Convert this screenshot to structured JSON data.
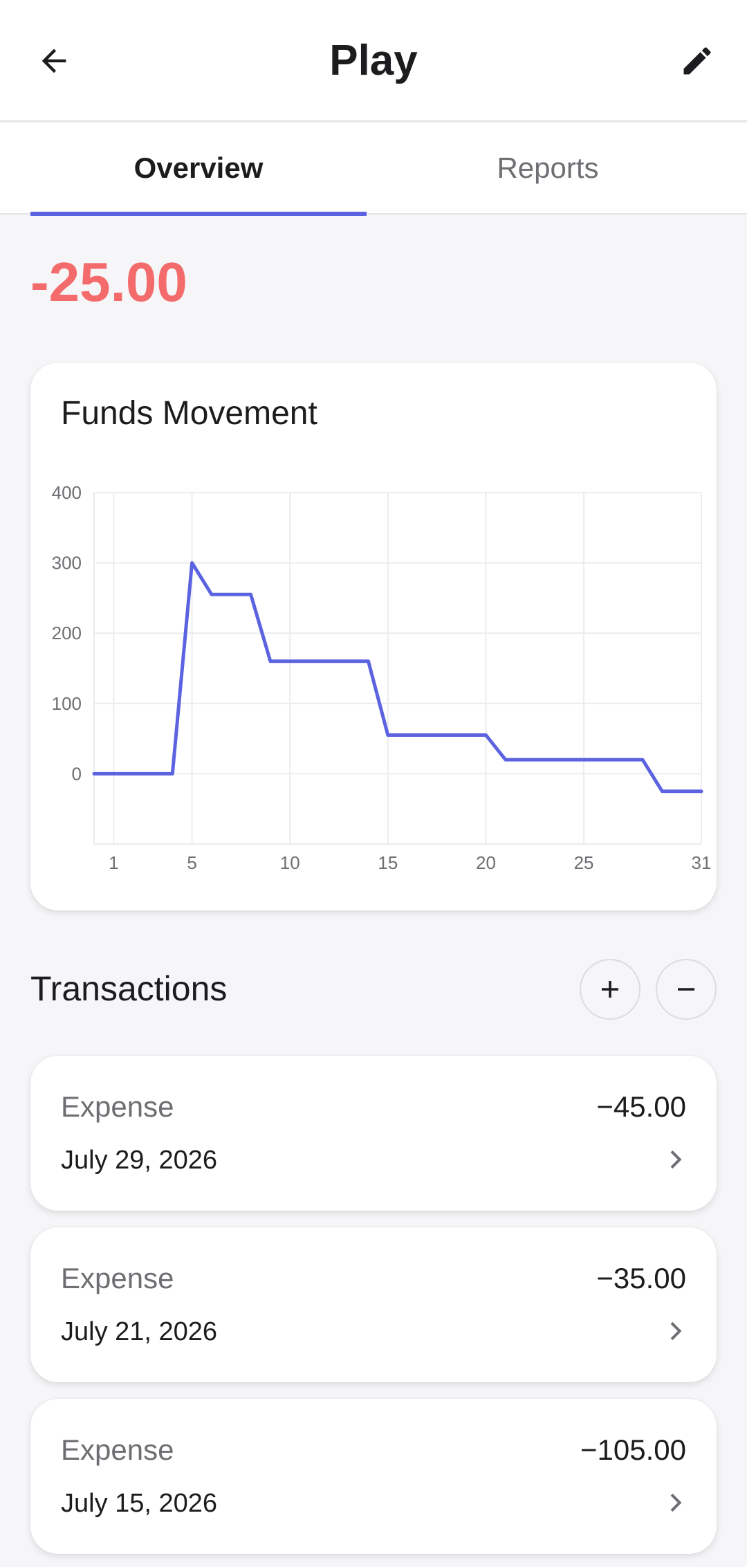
{
  "app_bar": {
    "title": "Play",
    "back_icon": "arrow-left-icon",
    "edit_icon": "pencil-icon"
  },
  "tabs": [
    {
      "label": "Overview",
      "active": true
    },
    {
      "label": "Reports",
      "active": false
    }
  ],
  "balance": {
    "value": "-25.00",
    "color": "#f36b6b"
  },
  "chart_card": {
    "title": "Funds Movement"
  },
  "chart_data": {
    "type": "line",
    "title": "Funds Movement",
    "xlabel": "",
    "ylabel": "",
    "x_ticks": [
      1,
      5,
      10,
      15,
      20,
      25,
      31
    ],
    "y_ticks": [
      0,
      100,
      200,
      300,
      400
    ],
    "xlim": [
      0,
      31
    ],
    "ylim": [
      -100,
      400
    ],
    "grid": true,
    "color": "#5c63e0",
    "series": [
      {
        "x": [
          0,
          4,
          5,
          6,
          8,
          9,
          14,
          15,
          20,
          21,
          28,
          29,
          31
        ],
        "y": [
          0,
          0,
          300,
          255,
          255,
          160,
          160,
          55,
          55,
          20,
          20,
          -25,
          -25
        ]
      }
    ]
  },
  "transactions": {
    "title": "Transactions",
    "add_icon": "plus-icon",
    "remove_icon": "minus-icon",
    "items": [
      {
        "type": "Expense",
        "amount": "−45.00",
        "date": "July 29, 2026"
      },
      {
        "type": "Expense",
        "amount": "−35.00",
        "date": "July 21, 2026"
      },
      {
        "type": "Expense",
        "amount": "−105.00",
        "date": "July 15, 2026"
      }
    ]
  },
  "colors": {
    "accent": "#5c63e0",
    "negative": "#f36b6b",
    "background": "#f6f6f8"
  }
}
